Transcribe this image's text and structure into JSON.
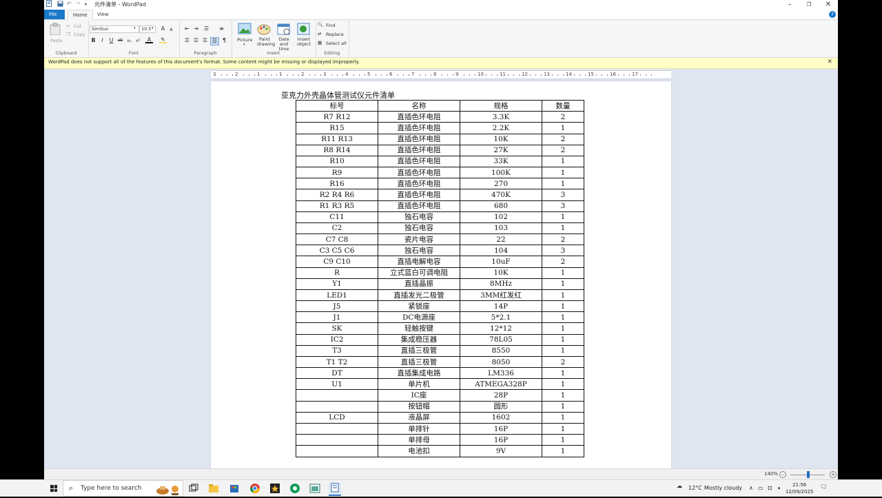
{
  "window": {
    "title": "元件清单 - WordPad",
    "tabs": [
      "File",
      "Home",
      "View"
    ]
  },
  "ribbon": {
    "clipboard": {
      "label": "Clipboard",
      "paste": "Paste",
      "cut": "Cut",
      "copy": "Copy"
    },
    "font": {
      "label": "Font",
      "family": "SimSun",
      "size": "10.5"
    },
    "paragraph": {
      "label": "Paragraph"
    },
    "insert": {
      "label": "Insert",
      "picture": "Picture",
      "paint": "Paint drawing",
      "datetime": "Date and time",
      "object": "Insert object"
    },
    "editing": {
      "label": "Editing",
      "find": "Find",
      "replace": "Replace",
      "select_all": "Select all"
    }
  },
  "infobar": {
    "message": "WordPad does not support all of the features of this document's format. Some content might be missing or displayed improperly."
  },
  "ruler": {
    "labels": [
      "3",
      "2",
      "1",
      "1",
      "2",
      "3",
      "4",
      "5",
      "6",
      "7",
      "8",
      "9",
      "10",
      "11",
      "12",
      "13",
      "14",
      "15",
      "16",
      "17"
    ]
  },
  "document": {
    "title": "亚克力外壳晶体管测试仪元件清单",
    "headers": [
      "标号",
      "名称",
      "规格",
      "数量"
    ],
    "rows": [
      [
        "R7  R12",
        "直插色环电阻",
        "3.3K",
        "2"
      ],
      [
        "R15",
        "直插色环电阻",
        "2.2K",
        "1"
      ],
      [
        "R11  R13",
        "直插色环电阻",
        "10K",
        "2"
      ],
      [
        "R8  R14",
        "直插色环电阻",
        "27K",
        "2"
      ],
      [
        "R10",
        "直插色环电阻",
        "33K",
        "1"
      ],
      [
        "R9",
        "直插色环电阻",
        "100K",
        "1"
      ],
      [
        "R16",
        "直插色环电阻",
        "270",
        "1"
      ],
      [
        "R2 R4 R6",
        "直插色环电阻",
        "470K",
        "3"
      ],
      [
        "R1 R3 R5",
        "直插色环电阻",
        "680",
        "3"
      ],
      [
        "C11",
        "独石电容",
        "102",
        "1"
      ],
      [
        "C2",
        "独石电容",
        "103",
        "1"
      ],
      [
        "C7 C8",
        "瓷片电容",
        "22",
        "2"
      ],
      [
        "C3 C5 C6",
        "独石电容",
        "104",
        "3"
      ],
      [
        "C9 C10",
        "直插电解电容",
        "10uF",
        "2"
      ],
      [
        "R",
        "立式蓝白可调电阻",
        "10K",
        "1"
      ],
      [
        "Y1",
        "直插晶振",
        "8MHz",
        "1"
      ],
      [
        "LED1",
        "直插发光二极管",
        "3MM红发红",
        "1"
      ],
      [
        "J5",
        "紧锁座",
        "14P",
        "1"
      ],
      [
        "J1",
        "DC电源座",
        "5*2.1",
        "1"
      ],
      [
        "SK",
        "轻触按键",
        "12*12",
        "1"
      ],
      [
        "IC2",
        "集成稳压器",
        "78L05",
        "1"
      ],
      [
        "T3",
        "直插三极管",
        "8550",
        "1"
      ],
      [
        "T1 T2",
        "直插三极管",
        "8050",
        "2"
      ],
      [
        "DT",
        "直插集成电路",
        "LM336",
        "1"
      ],
      [
        "U1",
        "单片机",
        "ATMEGA328P",
        "1"
      ],
      [
        "",
        "IC座",
        "28P",
        "1"
      ],
      [
        "",
        "按钮帽",
        "圆形",
        "1"
      ],
      [
        "LCD",
        "液晶屏",
        "1602",
        "1"
      ],
      [
        "",
        "单排针",
        "16P",
        "1"
      ],
      [
        "",
        "单排母",
        "16P",
        "1"
      ],
      [
        "",
        "电池扣",
        "9V",
        "1"
      ]
    ]
  },
  "statusbar": {
    "zoom": "140%"
  },
  "taskbar": {
    "search_placeholder": "Type here to search",
    "weather_temp": "12°C",
    "weather_desc": "Mostly cloudy",
    "time": "21:56",
    "date": "12/09/2025"
  }
}
